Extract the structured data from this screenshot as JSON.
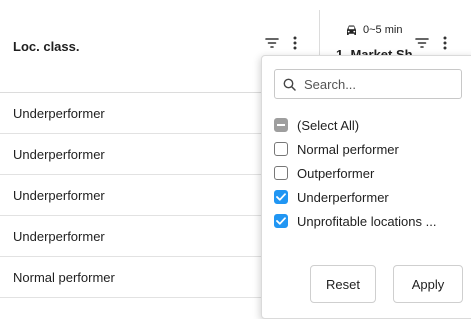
{
  "header": {
    "column1_title": "Loc. class.",
    "column2_top": "0~5 min",
    "column2_title": "1. Market Sh"
  },
  "rows": [
    "Underperformer",
    "Underperformer",
    "Underperformer",
    "Underperformer",
    "Normal performer"
  ],
  "filter": {
    "search_placeholder": "Search...",
    "options": [
      {
        "label": "(Select All)",
        "state": "indeterminate"
      },
      {
        "label": "Normal performer",
        "state": "unchecked"
      },
      {
        "label": "Outperformer",
        "state": "unchecked"
      },
      {
        "label": "Underperformer",
        "state": "checked"
      },
      {
        "label": "Unprofitable locations ...",
        "state": "checked"
      }
    ],
    "reset_label": "Reset",
    "apply_label": "Apply"
  },
  "colors": {
    "accent": "#2196f3",
    "indeterminate": "#9e9e9e",
    "border": "#dcdcdc"
  },
  "icons": [
    "filter-icon",
    "menu-dots-icon",
    "car-icon",
    "search-icon",
    "checkmark-icon",
    "minus-icon"
  ]
}
